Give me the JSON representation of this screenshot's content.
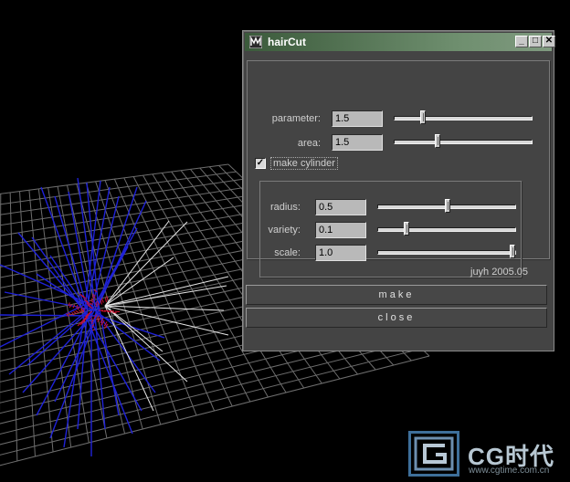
{
  "window": {
    "title": "hairCut",
    "controls": {
      "minimize": "_",
      "maximize": "□",
      "close": "✕"
    }
  },
  "fields": {
    "parameter": {
      "label": "parameter:",
      "value": "1.5",
      "slider": 0.2
    },
    "area": {
      "label": "area:",
      "value": "1.5",
      "slider": 0.31
    },
    "make_cylinder": {
      "label": "make cylinder",
      "checked": true
    },
    "radius": {
      "label": "radius:",
      "value": "0.5",
      "slider": 0.51
    },
    "variety": {
      "label": "variety:",
      "value": "0.1",
      "slider": 0.2
    },
    "scale": {
      "label": "scale:",
      "value": "1.0",
      "slider": 0.99
    }
  },
  "credit": "juyh 2005.05",
  "buttons": {
    "make": "make",
    "close": "close"
  },
  "watermark": {
    "brand": "CG时代",
    "url": "www.cgtime.com.cn"
  },
  "colors": {
    "title_bar_left": "#3b5a3b",
    "hair_blue": "#1f22d8",
    "hair_white": "#e8e8e8",
    "hair_red": "#d01030",
    "grid": "#7a7a7a"
  }
}
